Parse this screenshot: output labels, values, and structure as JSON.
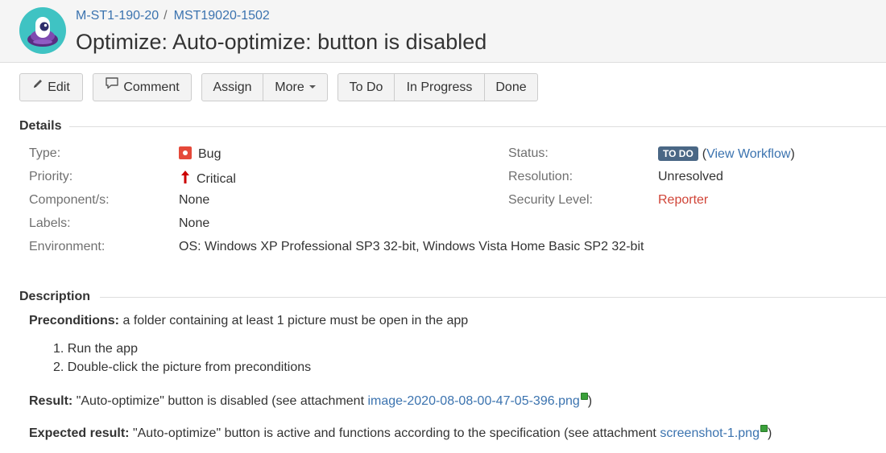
{
  "header": {
    "project_key": "M-ST1-190-20",
    "issue_key": "MST19020-1502",
    "title": "Optimize: Auto-optimize: button is disabled"
  },
  "toolbar": {
    "edit_label": "Edit",
    "comment_label": "Comment",
    "assign_label": "Assign",
    "more_label": "More",
    "todo_label": "To Do",
    "in_progress_label": "In Progress",
    "done_label": "Done"
  },
  "details": {
    "heading": "Details",
    "type_label": "Type:",
    "type_value": "Bug",
    "priority_label": "Priority:",
    "priority_value": "Critical",
    "components_label": "Component/s:",
    "components_value": "None",
    "labels_label": "Labels:",
    "labels_value": "None",
    "environment_label": "Environment:",
    "environment_value": "OS: Windows XP Professional SP3 32-bit, Windows Vista Home Basic SP2 32-bit",
    "status_label": "Status:",
    "status_value": "TO DO",
    "view_workflow_label": "View Workflow",
    "resolution_label": "Resolution:",
    "resolution_value": "Unresolved",
    "security_label": "Security Level:",
    "security_value": "Reporter"
  },
  "description": {
    "heading": "Description",
    "preconditions_label": "Preconditions:",
    "preconditions_text": "a folder containing at least 1 picture must be open in the app",
    "steps": [
      "1. Run the app",
      "2. Double-click the picture from preconditions"
    ],
    "result_label": "Result:",
    "result_text": "\"Auto-optimize\" button is disabled (see attachment",
    "result_attachment": "image-2020-08-08-00-47-05-396.png",
    "expected_label": "Expected result:",
    "expected_text": "\"Auto-optimize\" button is active and functions according to the specification (see attachment",
    "expected_attachment": "screenshot-1.png",
    "close_paren": ")"
  },
  "colors": {
    "link": "#3b73af",
    "status_lozenge": "#4a6785",
    "reporter": "#d04437",
    "bug": "#e5493a",
    "priority_critical": "#cc0000",
    "avatar_bg": "#3fc3c3"
  }
}
